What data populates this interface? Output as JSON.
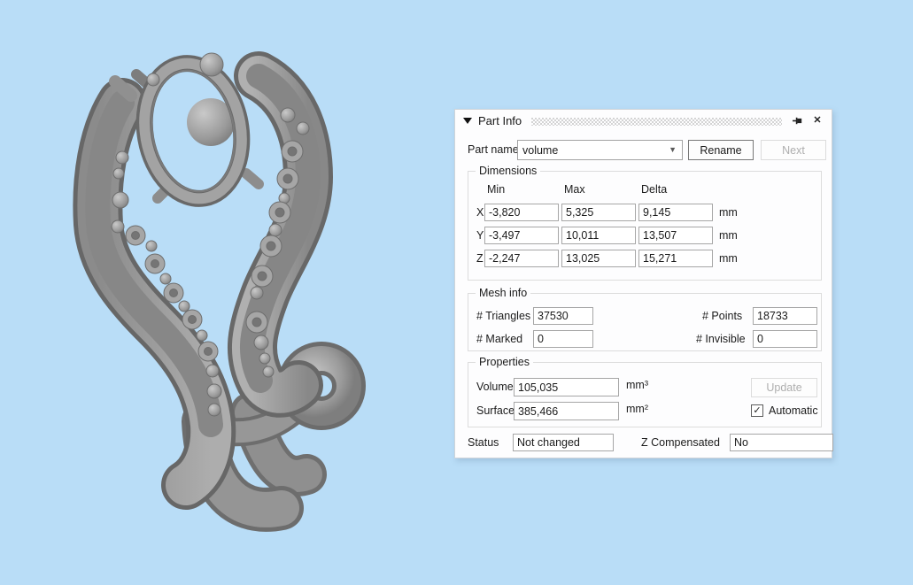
{
  "colors": {
    "background": "#b9ddf7",
    "panel_background": "#fdfdfe",
    "input_border": "#a6a6a6",
    "groupbox_border": "#dcdcdc",
    "disabled_text": "#aeaeae",
    "model_gray": "#9a9a9a"
  },
  "panel": {
    "title": "Part Info",
    "icons": {
      "collapse": "collapse-triangle-icon",
      "pin": "pin-icon",
      "close_glyph": "✕"
    },
    "part_name": {
      "label": "Part name",
      "value": "volume",
      "rename": "Rename",
      "next": "Next"
    },
    "dimensions": {
      "legend": "Dimensions",
      "col_min": "Min",
      "col_max": "Max",
      "col_delta": "Delta",
      "unit": "mm",
      "rows": [
        {
          "axis": "X",
          "min": "-3,820",
          "max": "5,325",
          "delta": "9,145"
        },
        {
          "axis": "Y",
          "min": "-3,497",
          "max": "10,011",
          "delta": "13,507"
        },
        {
          "axis": "Z",
          "min": "-2,247",
          "max": "13,025",
          "delta": "15,271"
        }
      ]
    },
    "mesh_info": {
      "legend": "Mesh info",
      "triangles_label": "# Triangles",
      "triangles_value": "37530",
      "points_label": "# Points",
      "points_value": "18733",
      "marked_label": "# Marked",
      "marked_value": "0",
      "invisible_label": "# Invisible",
      "invisible_value": "0"
    },
    "properties": {
      "legend": "Properties",
      "volume_label": "Volume",
      "volume_value": "105,035",
      "volume_unit": "mm³",
      "surface_label": "Surface",
      "surface_value": "385,466",
      "surface_unit": "mm²",
      "update": "Update",
      "automatic_label": "Automatic",
      "automatic_checked": true,
      "checkmark": "✓"
    },
    "status": {
      "label": "Status",
      "value": "Not changed"
    },
    "z_compensated": {
      "label": "Z Compensated",
      "value": "No"
    }
  }
}
